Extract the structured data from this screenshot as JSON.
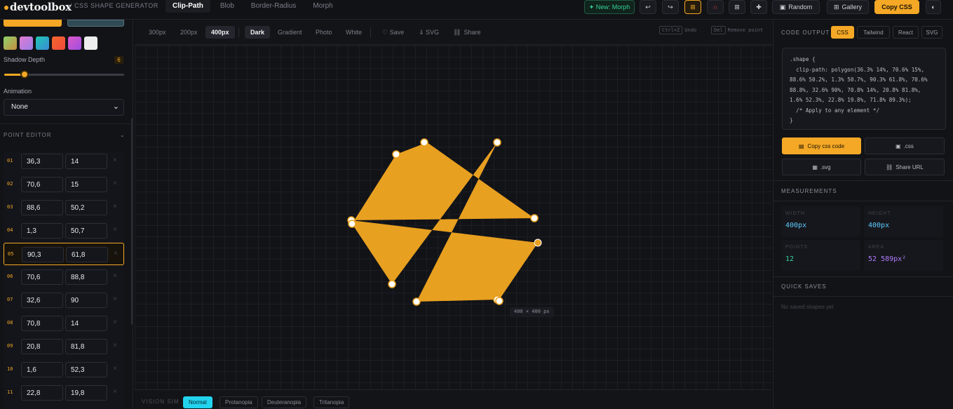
{
  "app": {
    "logo": "devtoolbox",
    "subtitle": "/ CSS SHAPE GENERATOR"
  },
  "top_tabs": [
    {
      "label": "Clip-Path",
      "active": true
    },
    {
      "label": "Blob",
      "active": false
    },
    {
      "label": "Border-Radius",
      "active": false
    },
    {
      "label": "Morph",
      "active": false
    }
  ],
  "toolbar": {
    "new_morph": "✦ New: Morph",
    "random": "Random",
    "gallery": "Gallery",
    "copy_css": "Copy CSS"
  },
  "left": {
    "presets": [
      "#5fbf6e",
      "#c873d9",
      "#22b5c9",
      "#f2672e",
      "#c94fd1",
      "#eeeeee"
    ],
    "shadow_depth_label": "Shadow Depth",
    "shadow_depth_value": "6",
    "shadow_depth_fraction": 0.17,
    "animation_label": "Animation",
    "animation_value": "None",
    "point_editor_title": "POINT EDITOR",
    "points": [
      {
        "idx": "01",
        "x": "36,3",
        "y": "14"
      },
      {
        "idx": "02",
        "x": "70,6",
        "y": "15"
      },
      {
        "idx": "03",
        "x": "88,6",
        "y": "50,2"
      },
      {
        "idx": "04",
        "x": "1,3",
        "y": "50,7"
      },
      {
        "idx": "05",
        "x": "90,3",
        "y": "61,8"
      },
      {
        "idx": "06",
        "x": "70,6",
        "y": "88,8"
      },
      {
        "idx": "07",
        "x": "32,6",
        "y": "90"
      },
      {
        "idx": "08",
        "x": "70,8",
        "y": "14"
      },
      {
        "idx": "09",
        "x": "20,8",
        "y": "81,8"
      },
      {
        "idx": "10",
        "x": "1,6",
        "y": "52,3"
      },
      {
        "idx": "11",
        "x": "22,8",
        "y": "19,8"
      }
    ],
    "selected_point": "05"
  },
  "canvas": {
    "sizes": [
      "300px",
      "200px",
      "400px"
    ],
    "active_size": "400px",
    "backgrounds": [
      "Dark",
      "Gradient",
      "Photo",
      "White"
    ],
    "active_background": "Dark",
    "save": "♡ Save",
    "svg": "⇓ SVG",
    "share": "Share",
    "undo_key": "Ctrl+Z",
    "undo_label": "Undo",
    "del_key": "Del",
    "del_label": "Remove point",
    "size_tag": "400 × 400 px",
    "shape_color": "#e8a020"
  },
  "vision": {
    "label": "VISION SIM",
    "modes": [
      "Normal",
      "Protanopia",
      "Deuteranopia",
      "Tritanopia"
    ],
    "active": "Normal"
  },
  "right": {
    "code_output_title": "CODE OUTPUT",
    "code_tabs": [
      "CSS",
      "Tailwind",
      "React",
      "SVG"
    ],
    "active_code_tab": "CSS",
    "code_lines": [
      ".shape {",
      "  clip-path: polygon(36.3% 14%, 70.6% 15%,",
      "88.6% 50.2%, 1.3% 50.7%, 90.3% 61.8%, 70.6%",
      "88.8%, 32.6% 90%, 70.8% 14%, 20.8% 81.8%,",
      "1.6% 52.3%, 22.8% 19.8%, 71.8% 89.3%);",
      "  /* Apply to any element */",
      "}"
    ],
    "copy_code": "Copy css code",
    "css_file": ".css",
    "svg_file": ".svg",
    "share_url": "Share URL",
    "measurements_title": "MEASUREMENTS",
    "width_label": "WIDTH",
    "width_value": "400px",
    "height_label": "HEIGHT",
    "height_value": "400px",
    "points_label": "POINTS",
    "points_value": "12",
    "area_label": "AREA",
    "area_value": "52 589px²",
    "quick_saves_title": "QUICK SAVES",
    "quick_saves_empty": "No saved shapes yet"
  }
}
